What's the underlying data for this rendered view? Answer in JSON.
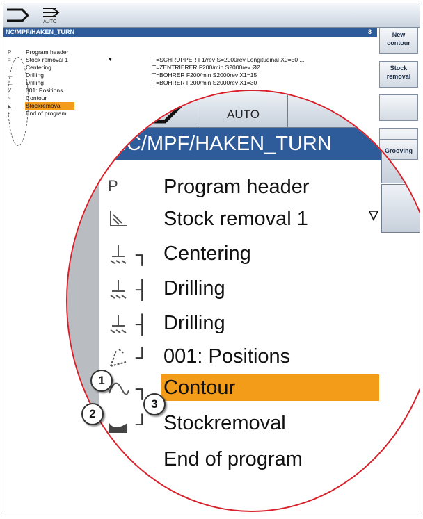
{
  "mode_bar": {
    "auto_label": "AUTO"
  },
  "title_bar": {
    "path": "NC/MPF/HAKEN_TURN",
    "count": "8"
  },
  "program_list": [
    {
      "icon": "P",
      "label": "Program header",
      "detail": ""
    },
    {
      "icon": "stock-removal",
      "label": "Stock removal 1",
      "detail": "T=SCHRUPPER F1/rev S=2000rev Longitudinal X0=50 ..."
    },
    {
      "icon": "centering",
      "label": "Centering",
      "detail": "T=ZENTRIERER F200/min S2000rev Ø2"
    },
    {
      "icon": "drilling",
      "label": "Drilling",
      "detail": "T=BOHRER F200/min S2000rev X1=15"
    },
    {
      "icon": "drilling",
      "label": "Drilling",
      "detail": "T=BOHRER F200/min S2000rev X1=30"
    },
    {
      "icon": "positions",
      "label": "001: Positions",
      "detail": ""
    },
    {
      "icon": "contour",
      "label": "Contour",
      "detail": ""
    },
    {
      "icon": "stock-removal-contour",
      "label": "Stockremoval",
      "detail": ""
    },
    {
      "icon": "END",
      "label": "End of program",
      "detail": ""
    }
  ],
  "softkeys": {
    "new_contour": "New contour",
    "stock_removal": "Stock removal",
    "grooving": "Grooving"
  },
  "callouts": [
    "1",
    "2",
    "3"
  ],
  "colors": {
    "title_bar": "#2e5b9a",
    "selection": "#f39c1a",
    "magnifier_border": "#d8202a"
  }
}
